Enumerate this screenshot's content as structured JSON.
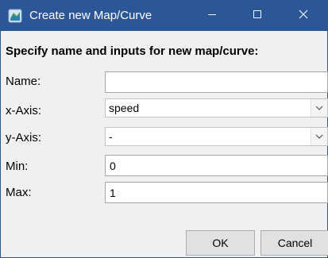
{
  "window": {
    "title": "Create new Map/Curve",
    "titlebar_color": "#2b5797",
    "icons": {
      "app": "map-curve-app-icon",
      "minimize": "minimize-icon",
      "maximize": "maximize-icon",
      "close": "close-icon"
    }
  },
  "form": {
    "heading": "Specify name and inputs for new map/curve:",
    "name": {
      "label": "Name:",
      "value": ""
    },
    "x_axis": {
      "label": "x-Axis:",
      "value": "speed"
    },
    "y_axis": {
      "label": "y-Axis:",
      "value": "-"
    },
    "min": {
      "label": "Min:",
      "value": "0"
    },
    "max": {
      "label": "Max:",
      "value": "1"
    }
  },
  "buttons": {
    "ok": "OK",
    "cancel": "Cancel"
  }
}
